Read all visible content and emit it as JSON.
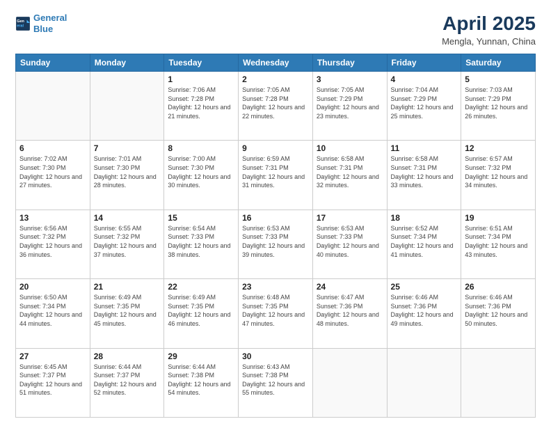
{
  "header": {
    "logo_line1": "General",
    "logo_line2": "Blue",
    "title": "April 2025",
    "subtitle": "Mengla, Yunnan, China"
  },
  "weekdays": [
    "Sunday",
    "Monday",
    "Tuesday",
    "Wednesday",
    "Thursday",
    "Friday",
    "Saturday"
  ],
  "weeks": [
    [
      {
        "day": "",
        "info": ""
      },
      {
        "day": "",
        "info": ""
      },
      {
        "day": "1",
        "info": "Sunrise: 7:06 AM\nSunset: 7:28 PM\nDaylight: 12 hours and 21 minutes."
      },
      {
        "day": "2",
        "info": "Sunrise: 7:05 AM\nSunset: 7:28 PM\nDaylight: 12 hours and 22 minutes."
      },
      {
        "day": "3",
        "info": "Sunrise: 7:05 AM\nSunset: 7:29 PM\nDaylight: 12 hours and 23 minutes."
      },
      {
        "day": "4",
        "info": "Sunrise: 7:04 AM\nSunset: 7:29 PM\nDaylight: 12 hours and 25 minutes."
      },
      {
        "day": "5",
        "info": "Sunrise: 7:03 AM\nSunset: 7:29 PM\nDaylight: 12 hours and 26 minutes."
      }
    ],
    [
      {
        "day": "6",
        "info": "Sunrise: 7:02 AM\nSunset: 7:30 PM\nDaylight: 12 hours and 27 minutes."
      },
      {
        "day": "7",
        "info": "Sunrise: 7:01 AM\nSunset: 7:30 PM\nDaylight: 12 hours and 28 minutes."
      },
      {
        "day": "8",
        "info": "Sunrise: 7:00 AM\nSunset: 7:30 PM\nDaylight: 12 hours and 30 minutes."
      },
      {
        "day": "9",
        "info": "Sunrise: 6:59 AM\nSunset: 7:31 PM\nDaylight: 12 hours and 31 minutes."
      },
      {
        "day": "10",
        "info": "Sunrise: 6:58 AM\nSunset: 7:31 PM\nDaylight: 12 hours and 32 minutes."
      },
      {
        "day": "11",
        "info": "Sunrise: 6:58 AM\nSunset: 7:31 PM\nDaylight: 12 hours and 33 minutes."
      },
      {
        "day": "12",
        "info": "Sunrise: 6:57 AM\nSunset: 7:32 PM\nDaylight: 12 hours and 34 minutes."
      }
    ],
    [
      {
        "day": "13",
        "info": "Sunrise: 6:56 AM\nSunset: 7:32 PM\nDaylight: 12 hours and 36 minutes."
      },
      {
        "day": "14",
        "info": "Sunrise: 6:55 AM\nSunset: 7:32 PM\nDaylight: 12 hours and 37 minutes."
      },
      {
        "day": "15",
        "info": "Sunrise: 6:54 AM\nSunset: 7:33 PM\nDaylight: 12 hours and 38 minutes."
      },
      {
        "day": "16",
        "info": "Sunrise: 6:53 AM\nSunset: 7:33 PM\nDaylight: 12 hours and 39 minutes."
      },
      {
        "day": "17",
        "info": "Sunrise: 6:53 AM\nSunset: 7:33 PM\nDaylight: 12 hours and 40 minutes."
      },
      {
        "day": "18",
        "info": "Sunrise: 6:52 AM\nSunset: 7:34 PM\nDaylight: 12 hours and 41 minutes."
      },
      {
        "day": "19",
        "info": "Sunrise: 6:51 AM\nSunset: 7:34 PM\nDaylight: 12 hours and 43 minutes."
      }
    ],
    [
      {
        "day": "20",
        "info": "Sunrise: 6:50 AM\nSunset: 7:34 PM\nDaylight: 12 hours and 44 minutes."
      },
      {
        "day": "21",
        "info": "Sunrise: 6:49 AM\nSunset: 7:35 PM\nDaylight: 12 hours and 45 minutes."
      },
      {
        "day": "22",
        "info": "Sunrise: 6:49 AM\nSunset: 7:35 PM\nDaylight: 12 hours and 46 minutes."
      },
      {
        "day": "23",
        "info": "Sunrise: 6:48 AM\nSunset: 7:35 PM\nDaylight: 12 hours and 47 minutes."
      },
      {
        "day": "24",
        "info": "Sunrise: 6:47 AM\nSunset: 7:36 PM\nDaylight: 12 hours and 48 minutes."
      },
      {
        "day": "25",
        "info": "Sunrise: 6:46 AM\nSunset: 7:36 PM\nDaylight: 12 hours and 49 minutes."
      },
      {
        "day": "26",
        "info": "Sunrise: 6:46 AM\nSunset: 7:36 PM\nDaylight: 12 hours and 50 minutes."
      }
    ],
    [
      {
        "day": "27",
        "info": "Sunrise: 6:45 AM\nSunset: 7:37 PM\nDaylight: 12 hours and 51 minutes."
      },
      {
        "day": "28",
        "info": "Sunrise: 6:44 AM\nSunset: 7:37 PM\nDaylight: 12 hours and 52 minutes."
      },
      {
        "day": "29",
        "info": "Sunrise: 6:44 AM\nSunset: 7:38 PM\nDaylight: 12 hours and 54 minutes."
      },
      {
        "day": "30",
        "info": "Sunrise: 6:43 AM\nSunset: 7:38 PM\nDaylight: 12 hours and 55 minutes."
      },
      {
        "day": "",
        "info": ""
      },
      {
        "day": "",
        "info": ""
      },
      {
        "day": "",
        "info": ""
      }
    ]
  ]
}
